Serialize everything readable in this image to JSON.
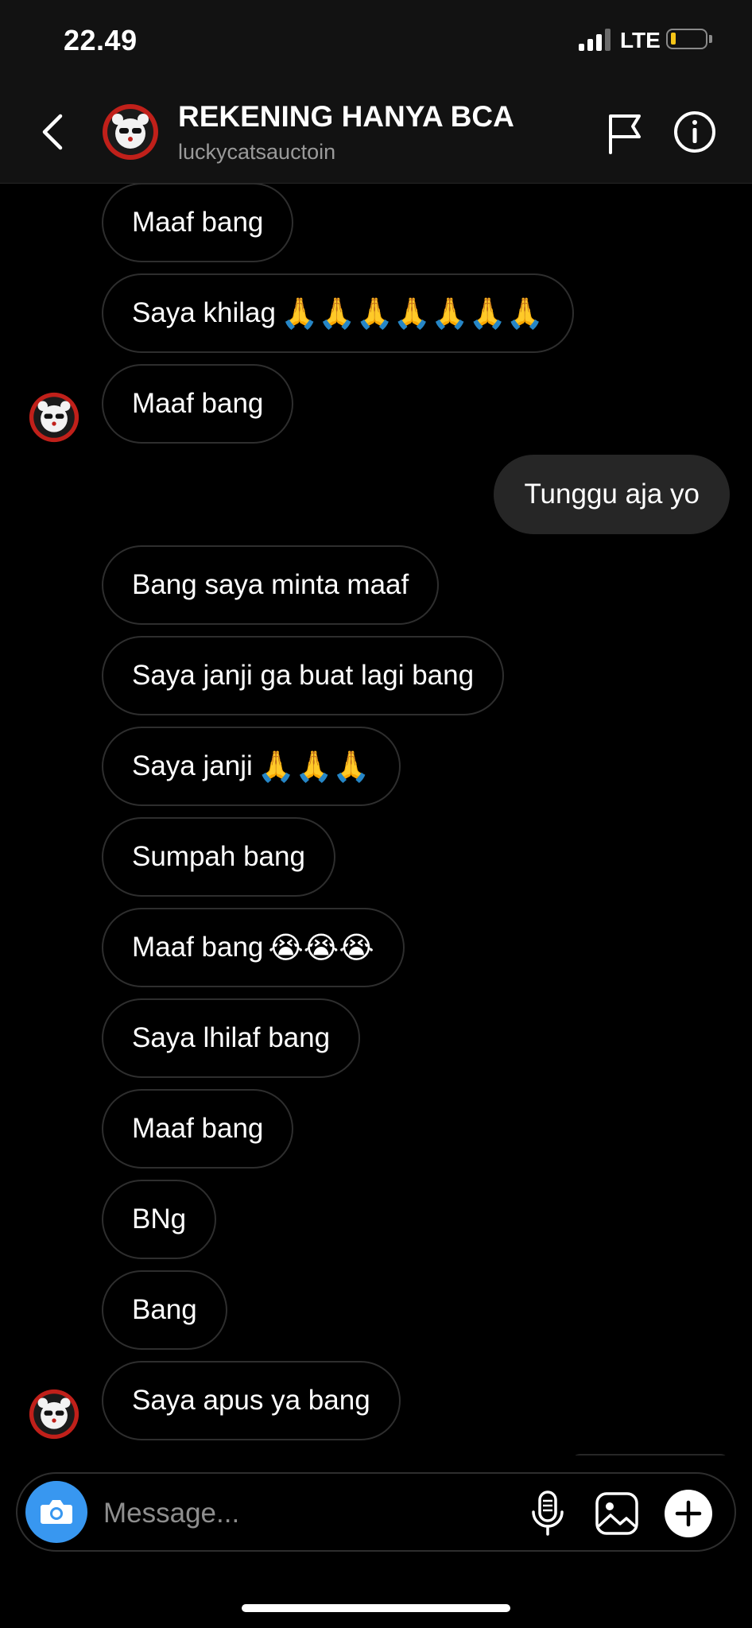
{
  "status_bar": {
    "time": "22.49",
    "network": "LTE"
  },
  "header": {
    "title": "REKENING HANYA BCA",
    "subtitle": "luckycatsauctoin"
  },
  "messages": [
    {
      "text": "Maaf bang",
      "emoji": ""
    },
    {
      "text": "Saya khilag",
      "emoji": "🙏🙏🙏🙏🙏🙏🙏"
    },
    {
      "text": "Maaf bang",
      "emoji": ""
    },
    {
      "text": "Tunggu aja yo",
      "emoji": ""
    },
    {
      "text": "Bang saya minta maaf",
      "emoji": ""
    },
    {
      "text": "Saya janji ga buat lagi bang",
      "emoji": ""
    },
    {
      "text": "Saya janji",
      "emoji": "🙏🙏🙏"
    },
    {
      "text": "Sumpah bang",
      "emoji": ""
    },
    {
      "text": "Maaf bang",
      "emoji": "😭😭😭"
    },
    {
      "text": "Saya lhilaf bang",
      "emoji": ""
    },
    {
      "text": "Maaf bang",
      "emoji": ""
    },
    {
      "text": "BNg",
      "emoji": ""
    },
    {
      "text": "Bang",
      "emoji": ""
    },
    {
      "text": "Saya apus ya bang",
      "emoji": ""
    }
  ],
  "composer": {
    "placeholder": "Message..."
  },
  "colors": {
    "background": "#000000",
    "bubble_outgoing": "#262626",
    "bubble_incoming_border": "#2e2e2e",
    "camera_accent": "#3897f0"
  },
  "icons": [
    "back-icon",
    "flag-icon",
    "info-icon",
    "camera-icon",
    "microphone-icon",
    "gallery-icon",
    "plus-icon"
  ]
}
